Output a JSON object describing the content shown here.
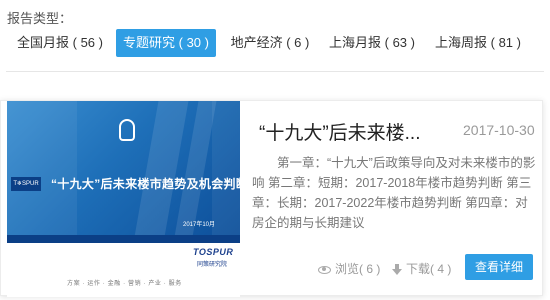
{
  "filter": {
    "label": "报告类型：",
    "tabs": [
      {
        "label": "全国月报 ( 56 )",
        "active": false
      },
      {
        "label": "专题研究 ( 30 )",
        "active": true
      },
      {
        "label": "地产经济 ( 6 )",
        "active": false
      },
      {
        "label": "上海月报 ( 63 )",
        "active": false
      },
      {
        "label": "上海周报 ( 81 )",
        "active": false
      }
    ]
  },
  "report": {
    "thumbnail": {
      "headline": "“十九大”后未来楼市趋势及机会判断",
      "date": "2017年10月",
      "tag": "T❄SPUR",
      "logo": "TOSPUR",
      "logo_sub": "同策研究院",
      "footer": "方案 · 运作 · 金融 · 营销 · 产业 · 服务"
    },
    "title": "“十九大”后未来楼...",
    "date": "2017-10-30",
    "description": "第一章：“十九大”后政策导向及对未来楼市的影响 第二章：短期：2017-2018年楼市趋势判断 第三章：长期：2017-2022年楼市趋势判断 第四章：对房企的期与长期建议",
    "views_label": "浏览( 6 )",
    "downloads_label": "下载( 4 )",
    "detail_button": "查看详细"
  },
  "colors": {
    "accent": "#2f9ee4",
    "muted_text": "#999999",
    "body_text": "#777777"
  },
  "icons": {
    "views": "eye-icon",
    "downloads": "download-arrow-icon"
  }
}
